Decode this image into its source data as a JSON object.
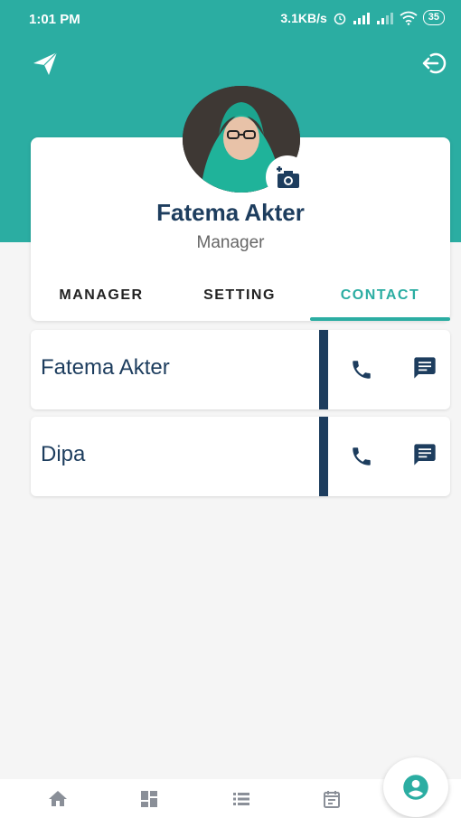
{
  "status_bar": {
    "time": "1:01 PM",
    "network_speed": "3.1KB/s",
    "battery": "35"
  },
  "header": {
    "send_icon": "send-icon",
    "logout_icon": "logout-icon",
    "accent_color": "#2bada2"
  },
  "profile": {
    "name": "Fatema Akter",
    "role": "Manager",
    "camera_icon": "add-photo-icon"
  },
  "tabs": [
    {
      "label": "MANAGER",
      "active": false
    },
    {
      "label": "SETTING",
      "active": false
    },
    {
      "label": "CONTACT",
      "active": true
    }
  ],
  "contacts": [
    {
      "name": "Fatema Akter",
      "call_icon": "phone-icon",
      "message_icon": "message-icon"
    },
    {
      "name": "Dipa",
      "call_icon": "phone-icon",
      "message_icon": "message-icon"
    }
  ],
  "bottom_nav": {
    "items": [
      "home-icon",
      "dashboard-icon",
      "list-icon",
      "calendar-icon"
    ],
    "fab_icon": "account-circle-icon"
  }
}
